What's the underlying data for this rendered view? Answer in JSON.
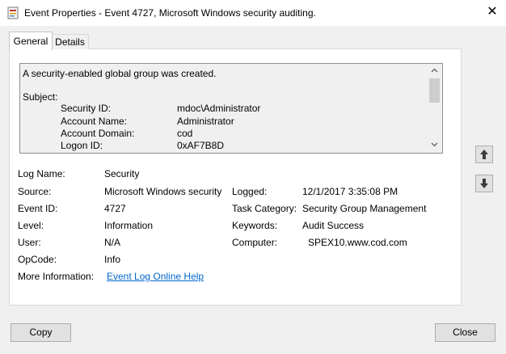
{
  "window": {
    "title": "Event Properties - Event 4727, Microsoft Windows security auditing.",
    "close_glyph": "✕"
  },
  "tabs": [
    {
      "label": "General",
      "selected": true
    },
    {
      "label": "Details",
      "selected": false
    }
  ],
  "message": {
    "summary": "A security-enabled global group was created.",
    "subject_label": "Subject:",
    "rows": [
      {
        "label": "Security ID:",
        "value": "mdoc\\Administrator"
      },
      {
        "label": "Account Name:",
        "value": "Administrator"
      },
      {
        "label": "Account Domain:",
        "value": "cod"
      },
      {
        "label": "Logon ID:",
        "value": "0xAF7B8D"
      }
    ]
  },
  "props": {
    "log_name": {
      "label": "Log Name:",
      "value": "Security"
    },
    "source": {
      "label": "Source:",
      "value": "Microsoft Windows security"
    },
    "logged": {
      "label": "Logged:",
      "value": "12/1/2017 3:35:08 PM"
    },
    "event_id": {
      "label": "Event ID:",
      "value": "4727"
    },
    "task_category": {
      "label": "Task Category:",
      "value": "Security Group Management"
    },
    "level": {
      "label": "Level:",
      "value": "Information"
    },
    "keywords": {
      "label": "Keywords:",
      "value": "Audit Success"
    },
    "user": {
      "label": "User:",
      "value": "N/A"
    },
    "computer": {
      "label": "Computer:",
      "value": "SPEX10.www.cod.com"
    },
    "opcode": {
      "label": "OpCode:",
      "value": "Info"
    },
    "more_info": {
      "label": "More Information:",
      "link": "Event Log Online Help"
    }
  },
  "buttons": {
    "copy": "Copy",
    "close": "Close"
  },
  "colors": {
    "link": "#0066cc",
    "window_bg": "#f0f0f0",
    "panel_bg": "#ffffff"
  }
}
